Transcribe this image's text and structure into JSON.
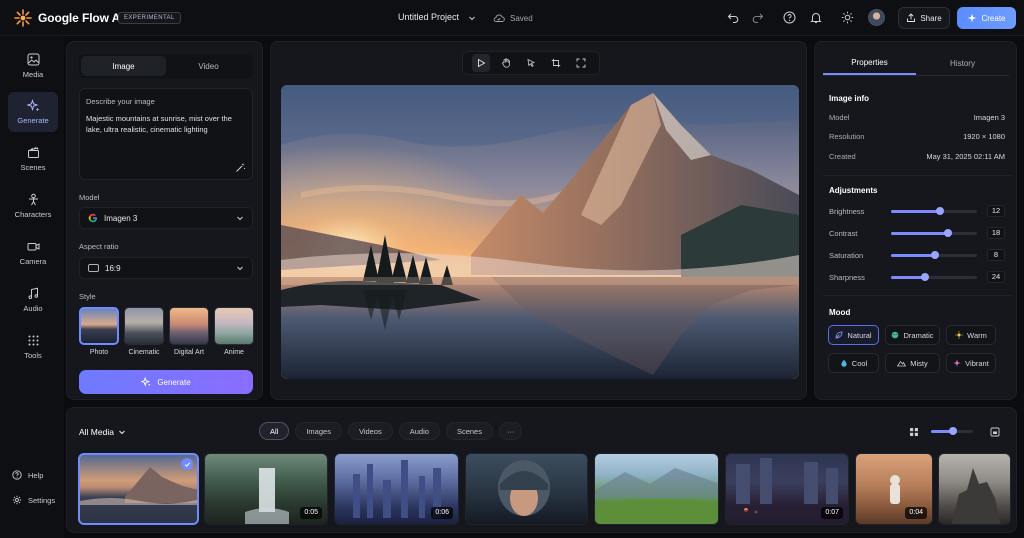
{
  "app": {
    "brand": "Google Flow AI",
    "badge": "EXPERIMENTAL",
    "project_title": "Untitled Project",
    "save_status": "Saved",
    "share_label": "Share",
    "create_label": "Create"
  },
  "nav": {
    "items": [
      {
        "label": "Media",
        "icon": "image-icon"
      },
      {
        "label": "Generate",
        "icon": "sparkle-icon"
      },
      {
        "label": "Scenes",
        "icon": "clapper-icon"
      },
      {
        "label": "Characters",
        "icon": "person-icon"
      },
      {
        "label": "Camera",
        "icon": "camera-icon"
      },
      {
        "label": "Audio",
        "icon": "music-icon"
      },
      {
        "label": "Tools",
        "icon": "grid-icon"
      }
    ],
    "active": "Generate",
    "help_label": "Help",
    "settings_label": "Settings"
  },
  "generate": {
    "tabs": [
      "Image",
      "Video"
    ],
    "active_tab": "Image",
    "prompt_label": "Describe your image",
    "prompt_text": "Majestic mountains at sunrise, mist over the lake, ultra realistic, cinematic lighting",
    "model_label": "Model",
    "model_value": "Imagen 3",
    "aspect_label": "Aspect ratio",
    "aspect_value": "16:9",
    "style_label": "Style",
    "styles": [
      "Photo",
      "Cinematic",
      "Digital Art",
      "Anime"
    ],
    "active_style": "Photo",
    "generate_label": "Generate"
  },
  "properties": {
    "tabs": [
      "Properties",
      "History"
    ],
    "active_tab": "Properties",
    "image_info_title": "Image info",
    "info": [
      {
        "key": "Model",
        "value": "Imagen 3"
      },
      {
        "key": "Resolution",
        "value": "1920 × 1080"
      },
      {
        "key": "Created",
        "value": "May 31, 2025 02:11 AM"
      }
    ],
    "adjustments_title": "Adjustments",
    "adjustments": [
      {
        "name": "Brightness",
        "value": "12",
        "level": 0.57
      },
      {
        "name": "Contrast",
        "value": "18",
        "level": 0.66
      },
      {
        "name": "Saturation",
        "value": "8",
        "level": 0.51
      },
      {
        "name": "Sharpness",
        "value": "24",
        "level": 0.4
      }
    ],
    "mood_title": "Mood",
    "moods": [
      "Natural",
      "Dramatic",
      "Warm",
      "Cool",
      "Misty",
      "Vibrant"
    ],
    "active_mood": "Natural"
  },
  "media": {
    "title": "All Media",
    "filters": [
      "All",
      "Images",
      "Videos",
      "Audio",
      "Scenes",
      "···"
    ],
    "active_filter": "All",
    "thumbs": [
      {
        "kind": "image",
        "duration": ""
      },
      {
        "kind": "video",
        "duration": "0:05"
      },
      {
        "kind": "video",
        "duration": "0:06"
      },
      {
        "kind": "image",
        "duration": ""
      },
      {
        "kind": "image",
        "duration": ""
      },
      {
        "kind": "video",
        "duration": "0:07"
      },
      {
        "kind": "video",
        "duration": "0:04"
      },
      {
        "kind": "image",
        "duration": ""
      }
    ]
  },
  "colors": {
    "accent": "#6f8bff",
    "create": "#5b8cff",
    "generate_from": "#6e7bff",
    "generate_to": "#8a6dff"
  }
}
